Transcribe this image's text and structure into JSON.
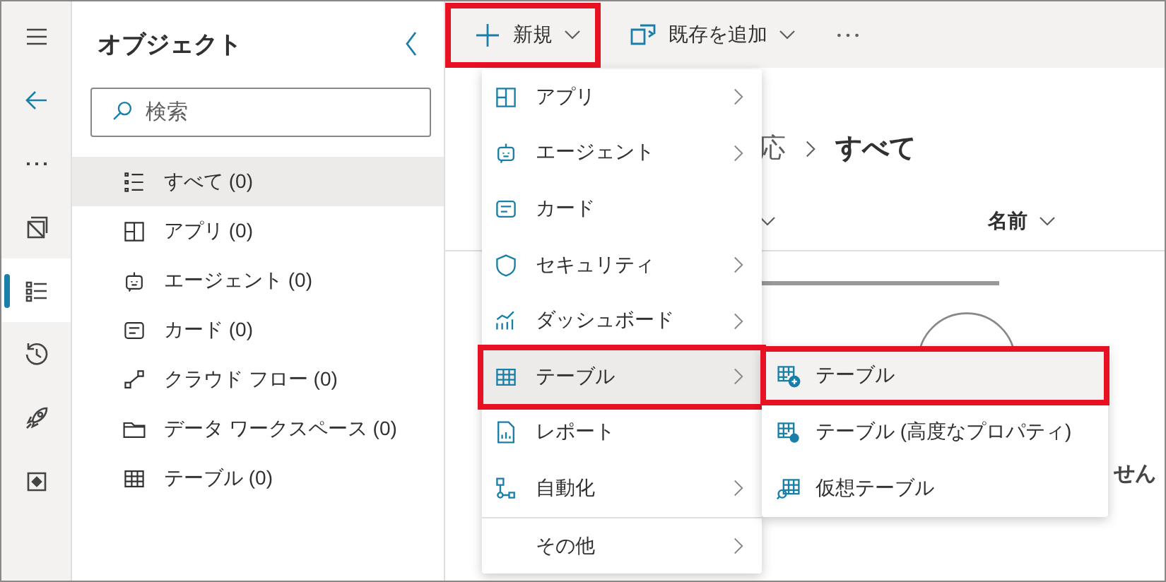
{
  "rail": {
    "items": [
      {
        "kind": "menu",
        "selected": false
      },
      {
        "kind": "back",
        "selected": false
      },
      {
        "kind": "more",
        "selected": false
      },
      {
        "kind": "pages",
        "selected": false
      },
      {
        "kind": "objects",
        "selected": true
      },
      {
        "kind": "history",
        "selected": false
      },
      {
        "kind": "rocket",
        "selected": false
      },
      {
        "kind": "publish",
        "selected": false
      }
    ]
  },
  "panel": {
    "title": "オブジェクト",
    "search": {
      "placeholder": "検索"
    },
    "items": [
      {
        "label": "すべて (0)",
        "kind": "all",
        "selected": true
      },
      {
        "label": "アプリ (0)",
        "kind": "app",
        "selected": false
      },
      {
        "label": "エージェント (0)",
        "kind": "agent",
        "selected": false
      },
      {
        "label": "カード (0)",
        "kind": "card",
        "selected": false
      },
      {
        "label": "クラウド フロー (0)",
        "kind": "flow",
        "selected": false
      },
      {
        "label": "データ ワークスペース (0)",
        "kind": "folder",
        "selected": false
      },
      {
        "label": "テーブル (0)",
        "kind": "table",
        "selected": false
      }
    ]
  },
  "toolbar": {
    "buttons": [
      {
        "label": "新規",
        "kind": "plus",
        "highlighted": true
      },
      {
        "label": "既存を追加",
        "kind": "add",
        "highlighted": false
      }
    ]
  },
  "main": {
    "breadcrumb": [
      "応",
      "すべて"
    ],
    "column_header": "名前",
    "empty_text": "せん"
  },
  "menu": {
    "items": [
      {
        "label": "アプリ",
        "kind": "app",
        "submenu": true,
        "selected": false,
        "highlighted": false
      },
      {
        "label": "エージェント",
        "kind": "agent",
        "submenu": true,
        "selected": false,
        "highlighted": false
      },
      {
        "label": "カード",
        "kind": "card",
        "submenu": false,
        "selected": false,
        "highlighted": false
      },
      {
        "label": "セキュリティ",
        "kind": "security",
        "submenu": true,
        "selected": false,
        "highlighted": false
      },
      {
        "label": "ダッシュボード",
        "kind": "dashboard",
        "submenu": true,
        "selected": false,
        "highlighted": false
      },
      {
        "label": "テーブル",
        "kind": "table",
        "submenu": true,
        "selected": true,
        "highlighted": true
      },
      {
        "label": "レポート",
        "kind": "report",
        "submenu": false,
        "selected": false,
        "highlighted": false
      },
      {
        "label": "自動化",
        "kind": "automation",
        "submenu": true,
        "selected": false,
        "highlighted": false
      }
    ],
    "footer_items": [
      {
        "label": "その他",
        "submenu": true
      }
    ]
  },
  "submenu": {
    "items": [
      {
        "label": "テーブル",
        "kind": "tableadd",
        "selected": true,
        "highlighted": true
      },
      {
        "label": "テーブル (高度なプロパティ)",
        "kind": "tablegear",
        "selected": false,
        "highlighted": false
      },
      {
        "label": "仮想テーブル",
        "kind": "virtual",
        "selected": false,
        "highlighted": false
      }
    ]
  }
}
